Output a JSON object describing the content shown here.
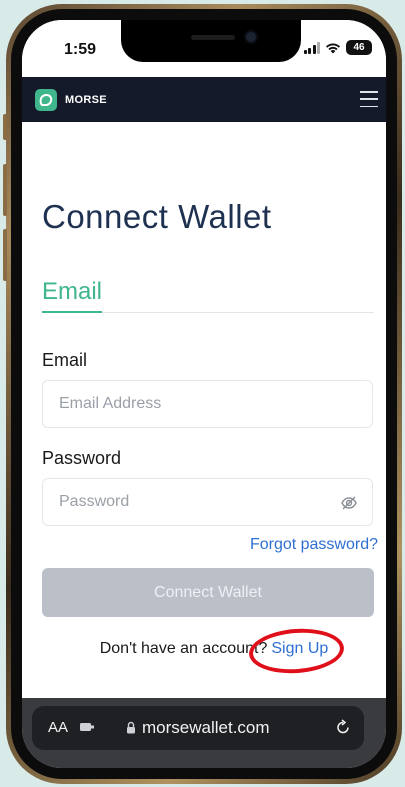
{
  "status_bar": {
    "time": "1:59",
    "battery": "46"
  },
  "header": {
    "brand": "MORSE",
    "brand_color": "#3fb68b"
  },
  "page": {
    "title": "Connect Wallet",
    "active_tab": "Email",
    "email_label": "Email",
    "email_placeholder": "Email Address",
    "password_label": "Password",
    "password_placeholder": "Password",
    "forgot_link": "Forgot password?",
    "connect_button": "Connect Wallet",
    "signup_prompt": "Don't have an account?",
    "signup_link": "Sign Up"
  },
  "browser": {
    "aa_label": "AA",
    "url": "morsewallet.com"
  },
  "icons": {
    "menu": "hamburger-menu-icon",
    "password_toggle": "eye-slash-icon",
    "lock": "lock-icon",
    "reload": "reload-icon"
  },
  "colors": {
    "header_bg": "#141a29",
    "title": "#1e3150",
    "accent_green": "#3fb68b",
    "link_blue": "#2f6fd3",
    "button_disabled": "#babfc8",
    "annotation_red": "#e0101a"
  }
}
